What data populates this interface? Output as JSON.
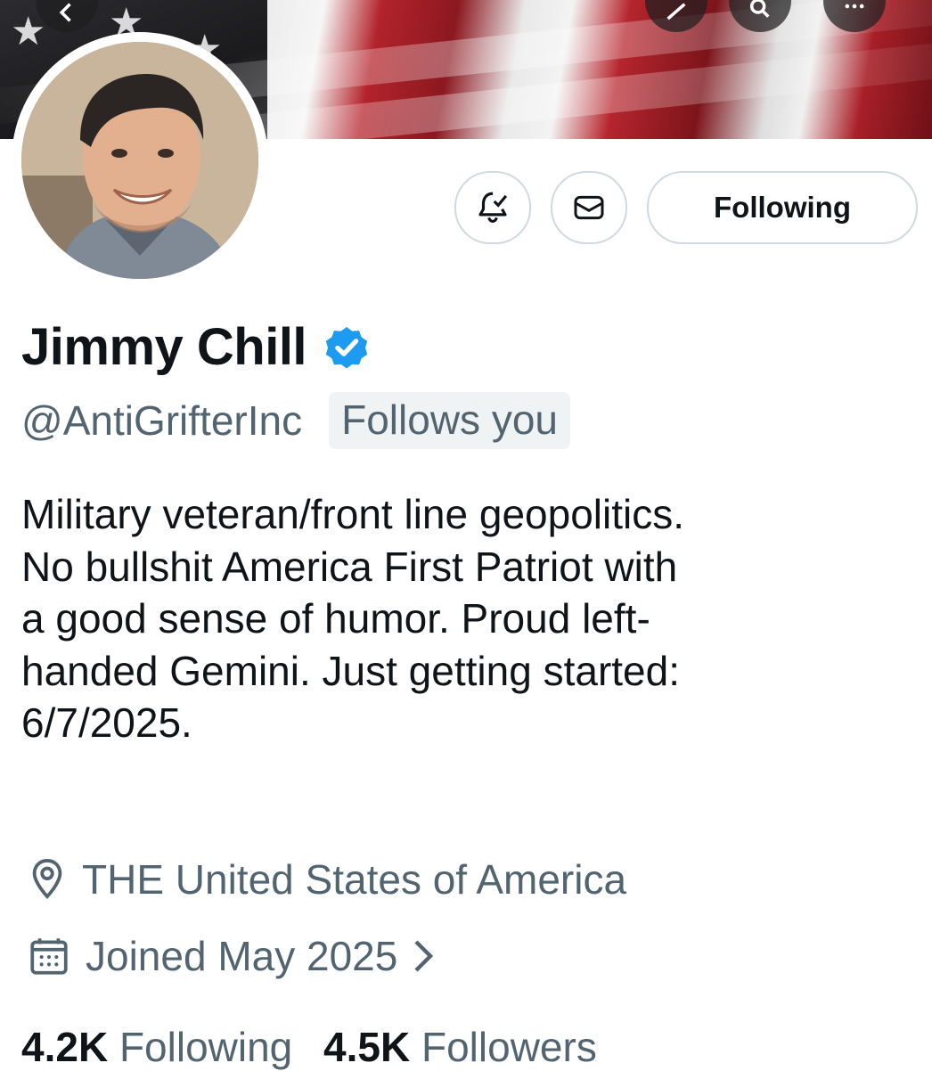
{
  "profile": {
    "display_name": "Jimmy Chill",
    "handle": "@AntiGrifterInc",
    "follows_you_badge": "Follows you",
    "bio": "Military veteran/front line geopolitics.\nNo bullshit America First Patriot with\na good sense of humor. Proud left-\nhanded Gemini. Just getting started:\n6/7/2025.",
    "location": "THE United States of America",
    "joined": "Joined May 2025"
  },
  "actions": {
    "following_button_label": "Following"
  },
  "stats": {
    "following_count": "4.2K",
    "following_label": "Following",
    "followers_count": "4.5K",
    "followers_label": "Followers"
  },
  "colors": {
    "verified_blue": "#1d9bf0",
    "secondary_text": "#536471",
    "primary_text": "#0f1419",
    "button_border": "#cfd9de",
    "badge_bg": "#eff3f4"
  },
  "icons": {
    "notifications": "bell-check-icon",
    "message": "envelope-icon",
    "verified": "verified-badge-icon",
    "location": "map-pin-icon",
    "joined": "calendar-icon",
    "joined_more": "chevron-right-icon"
  }
}
